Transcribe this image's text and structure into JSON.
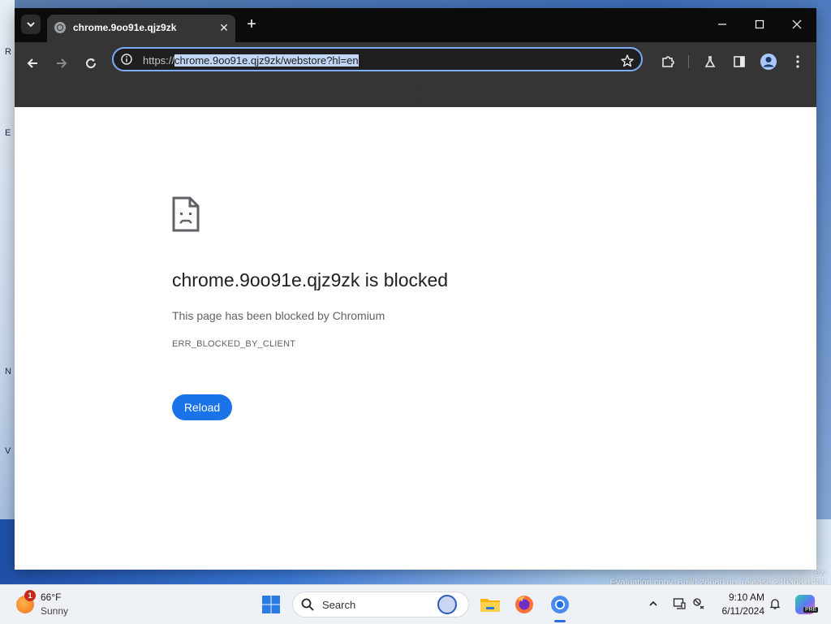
{
  "desktop": {
    "watermark_line1": "ew",
    "watermark_line2": "Evaluation copy. Build 26080.ge_release.240308-1400"
  },
  "browser": {
    "tab": {
      "title": "chrome.9oo91e.qjz9zk"
    },
    "address": {
      "scheme": "https://",
      "host_path": "chrome.9oo91e.qjz9zk/webstore?hl=en"
    },
    "colors": {
      "accent": "#7cacf8",
      "frame": "#353535",
      "tabstrip": "#0b0b0b"
    }
  },
  "error_page": {
    "heading": "chrome.9oo91e.qjz9zk is blocked",
    "description": "This page has been blocked by Chromium",
    "error_code": "ERR_BLOCKED_BY_CLIENT",
    "reload_label": "Reload",
    "button_color": "#1a73e8"
  },
  "taskbar": {
    "weather": {
      "badge": "1",
      "temp": "66°F",
      "condition": "Sunny"
    },
    "search_label": "Search",
    "clock": {
      "time": "9:10 AM",
      "date": "6/11/2024"
    },
    "copilot_badge": "PRE"
  }
}
